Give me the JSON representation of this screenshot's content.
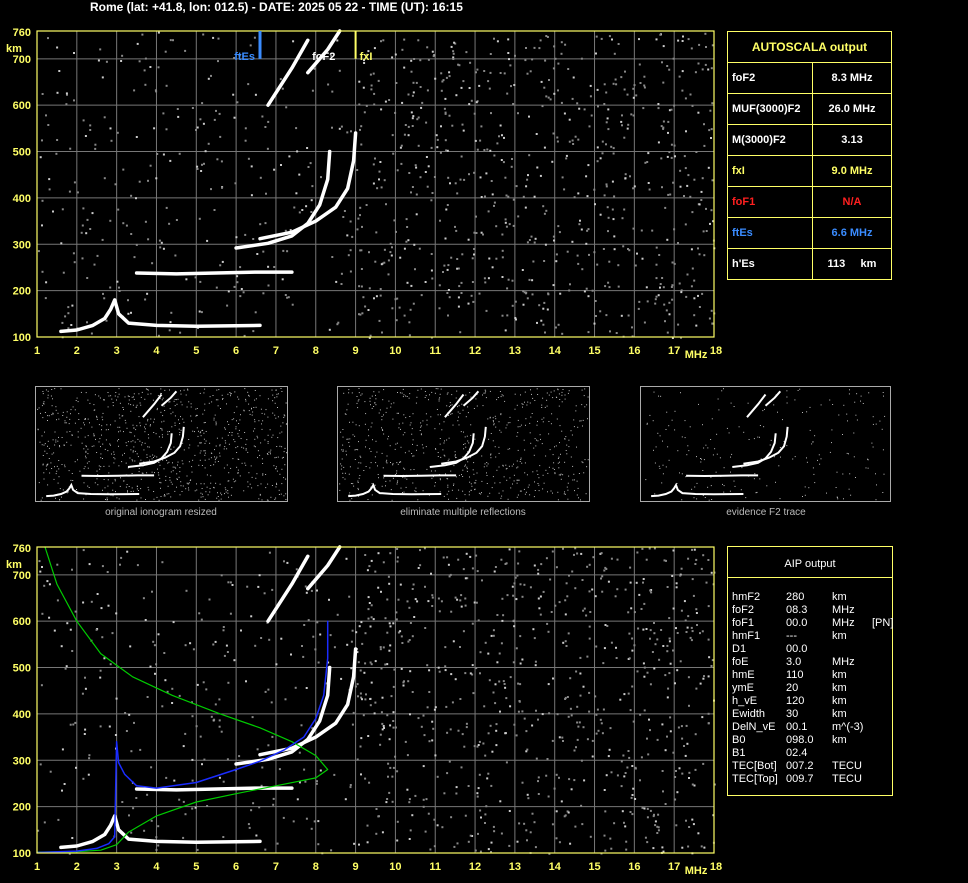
{
  "header": {
    "title": "Rome (lat: +41.8, lon: 012.5) - DATE: 2025 05 22 - TIME (UT): 16:15"
  },
  "autoscala": {
    "title": "AUTOSCALA output",
    "rows": [
      {
        "label": "foF2",
        "value": "8.3 MHz",
        "color": "#ffffff"
      },
      {
        "label": "MUF(3000)F2",
        "value": "26.0 MHz",
        "color": "#ffffff"
      },
      {
        "label": "M(3000)F2",
        "value": "3.13",
        "color": "#ffffff"
      },
      {
        "label": "fxI",
        "value": "9.0 MHz",
        "color": "#ffff66"
      },
      {
        "label": "foF1",
        "value": "N/A",
        "color": "#ff2020"
      },
      {
        "label": "ftEs",
        "value": "6.6 MHz",
        "color": "#3a8cff"
      },
      {
        "label": "h'Es",
        "value": "113     km",
        "color": "#ffffff"
      }
    ]
  },
  "aip": {
    "title": "AIP output",
    "rows": [
      [
        "hmF2",
        "280",
        "km",
        ""
      ],
      [
        "foF2",
        "08.3",
        "MHz",
        ""
      ],
      [
        "foF1",
        "00.0",
        "MHz",
        "[PN]"
      ],
      [
        "hmF1",
        "---",
        "km",
        ""
      ],
      [
        "D1",
        "00.0",
        "",
        ""
      ],
      [
        "foE",
        "3.0",
        "MHz",
        ""
      ],
      [
        "hmE",
        "110",
        "km",
        ""
      ],
      [
        "ymE",
        "20",
        "km",
        ""
      ],
      [
        "h_vE",
        "120",
        "km",
        ""
      ],
      [
        "Ewidth",
        "30",
        "km",
        ""
      ],
      [
        "DelN_vE",
        "00.1",
        "m^(-3)",
        ""
      ],
      [
        "B0",
        "098.0",
        "km",
        ""
      ],
      [
        "B1",
        "02.4",
        "",
        ""
      ],
      [
        "TEC[Bot]",
        "007.2",
        "TECU",
        ""
      ],
      [
        "TEC[Top]",
        "009.7",
        "TECU",
        ""
      ]
    ]
  },
  "captions": [
    "original ionogram resized",
    "eliminate multiple reflections",
    "evidence F2 trace"
  ],
  "colors": {
    "grid": "#777777",
    "frame": "#ffff66",
    "axis_text": "#ffff66",
    "trace": "#ffffff",
    "profile": "#00cc00",
    "blue": "#1a2cff"
  },
  "chart_data": [
    {
      "type": "scatter",
      "title": "",
      "xlabel": "MHz",
      "ylabel": "km",
      "xlim": [
        1,
        18
      ],
      "ylim": [
        100,
        760
      ],
      "x_ticks": [
        1,
        2,
        3,
        4,
        5,
        6,
        7,
        8,
        9,
        10,
        11,
        12,
        13,
        14,
        15,
        16,
        17,
        18
      ],
      "y_ticks": [
        100,
        200,
        300,
        400,
        500,
        600,
        700,
        760
      ],
      "grid": true,
      "markers": [
        {
          "label": "ftEs",
          "x": 6.6,
          "color": "#3a8cff"
        },
        {
          "label": "foF2",
          "x": 8.3,
          "color": "#ffffff"
        },
        {
          "label": "fxI",
          "x": 9.0,
          "color": "#ffff66"
        }
      ],
      "series": [
        {
          "values": [
            [
              1.6,
              112
            ],
            [
              2,
              115
            ],
            [
              2.4,
              125
            ],
            [
              2.7,
              140
            ],
            [
              2.85,
              160
            ],
            [
              2.95,
              180
            ],
            [
              3.05,
              150
            ],
            [
              3.3,
              130
            ],
            [
              4,
              125
            ],
            [
              5,
              123
            ],
            [
              6.6,
              125
            ]
          ]
        },
        {
          "values": [
            [
              3.5,
              238
            ],
            [
              4.5,
              236
            ],
            [
              5.5,
              238
            ],
            [
              6.5,
              240
            ],
            [
              7.4,
              240
            ]
          ]
        },
        {
          "values": [
            [
              6,
              292
            ],
            [
              6.8,
              302
            ],
            [
              7.4,
              318
            ],
            [
              7.8,
              345
            ],
            [
              8.1,
              385
            ],
            [
              8.3,
              440
            ],
            [
              8.35,
              500
            ]
          ]
        },
        {
          "values": [
            [
              6.6,
              312
            ],
            [
              7.4,
              326
            ],
            [
              8,
              350
            ],
            [
              8.5,
              380
            ],
            [
              8.8,
              420
            ],
            [
              8.95,
              480
            ],
            [
              9,
              540
            ]
          ]
        },
        {
          "values": [
            [
              7.8,
              670
            ],
            [
              8.3,
              720
            ],
            [
              8.6,
              760
            ]
          ]
        },
        {
          "values": [
            [
              6.8,
              600
            ],
            [
              7.4,
              680
            ],
            [
              7.8,
              740
            ]
          ]
        }
      ]
    },
    {
      "type": "line",
      "title": "",
      "xlabel": "MHz",
      "ylabel": "km",
      "xlim": [
        1,
        18
      ],
      "ylim": [
        100,
        760
      ],
      "x_ticks": [
        1,
        2,
        3,
        4,
        5,
        6,
        7,
        8,
        9,
        10,
        11,
        12,
        13,
        14,
        15,
        16,
        17,
        18
      ],
      "y_ticks": [
        100,
        200,
        300,
        400,
        500,
        600,
        700,
        760
      ],
      "grid": true,
      "series": [
        {
          "values": [
            [
              1.6,
              112
            ],
            [
              2,
              115
            ],
            [
              2.4,
              125
            ],
            [
              2.7,
              140
            ],
            [
              2.85,
              160
            ],
            [
              2.95,
              180
            ],
            [
              3.05,
              150
            ],
            [
              3.3,
              130
            ],
            [
              4,
              125
            ],
            [
              5,
              123
            ],
            [
              6.6,
              125
            ]
          ]
        },
        {
          "values": [
            [
              3.5,
              238
            ],
            [
              4.5,
              236
            ],
            [
              5.5,
              238
            ],
            [
              6.5,
              240
            ],
            [
              7.4,
              240
            ]
          ]
        },
        {
          "values": [
            [
              6,
              292
            ],
            [
              6.8,
              302
            ],
            [
              7.4,
              318
            ],
            [
              7.8,
              345
            ],
            [
              8.1,
              385
            ],
            [
              8.3,
              440
            ],
            [
              8.35,
              500
            ]
          ]
        },
        {
          "values": [
            [
              6.6,
              312
            ],
            [
              7.4,
              326
            ],
            [
              8,
              350
            ],
            [
              8.5,
              380
            ],
            [
              8.8,
              420
            ],
            [
              8.95,
              480
            ],
            [
              9,
              540
            ]
          ]
        },
        {
          "values": [
            [
              7.8,
              670
            ],
            [
              8.3,
              720
            ],
            [
              8.6,
              760
            ]
          ]
        },
        {
          "values": [
            [
              6.8,
              600
            ],
            [
              7.4,
              680
            ],
            [
              7.8,
              740
            ]
          ]
        },
        {
          "values": [
            [
              1.2,
              760
            ],
            [
              1.5,
              680
            ],
            [
              2,
              600
            ],
            [
              2.6,
              530
            ],
            [
              3.4,
              480
            ],
            [
              4.4,
              440
            ],
            [
              5.6,
              400
            ],
            [
              6.6,
              370
            ],
            [
              7.4,
              340
            ],
            [
              8,
              310
            ],
            [
              8.3,
              280
            ],
            [
              8,
              262
            ],
            [
              7,
              245
            ],
            [
              6,
              228
            ],
            [
              5,
              210
            ],
            [
              4,
              180
            ],
            [
              3.3,
              145
            ],
            [
              3,
              118
            ],
            [
              2.6,
              106
            ],
            [
              2,
              103
            ],
            [
              1,
              102
            ]
          ]
        },
        {
          "values": [
            [
              1,
              101
            ],
            [
              2,
              104
            ],
            [
              2.5,
              110
            ],
            [
              2.8,
              120
            ],
            [
              2.95,
              135
            ],
            [
              3,
              340
            ],
            [
              3.05,
              295
            ],
            [
              3.2,
              270
            ],
            [
              3.5,
              245
            ],
            [
              4,
              240
            ],
            [
              5,
              252
            ],
            [
              6,
              280
            ],
            [
              6.6,
              298
            ],
            [
              7.2,
              322
            ],
            [
              7.7,
              350
            ],
            [
              8,
              390
            ],
            [
              8.2,
              440
            ],
            [
              8.3,
              520
            ],
            [
              8.3,
              600
            ]
          ]
        }
      ]
    }
  ]
}
